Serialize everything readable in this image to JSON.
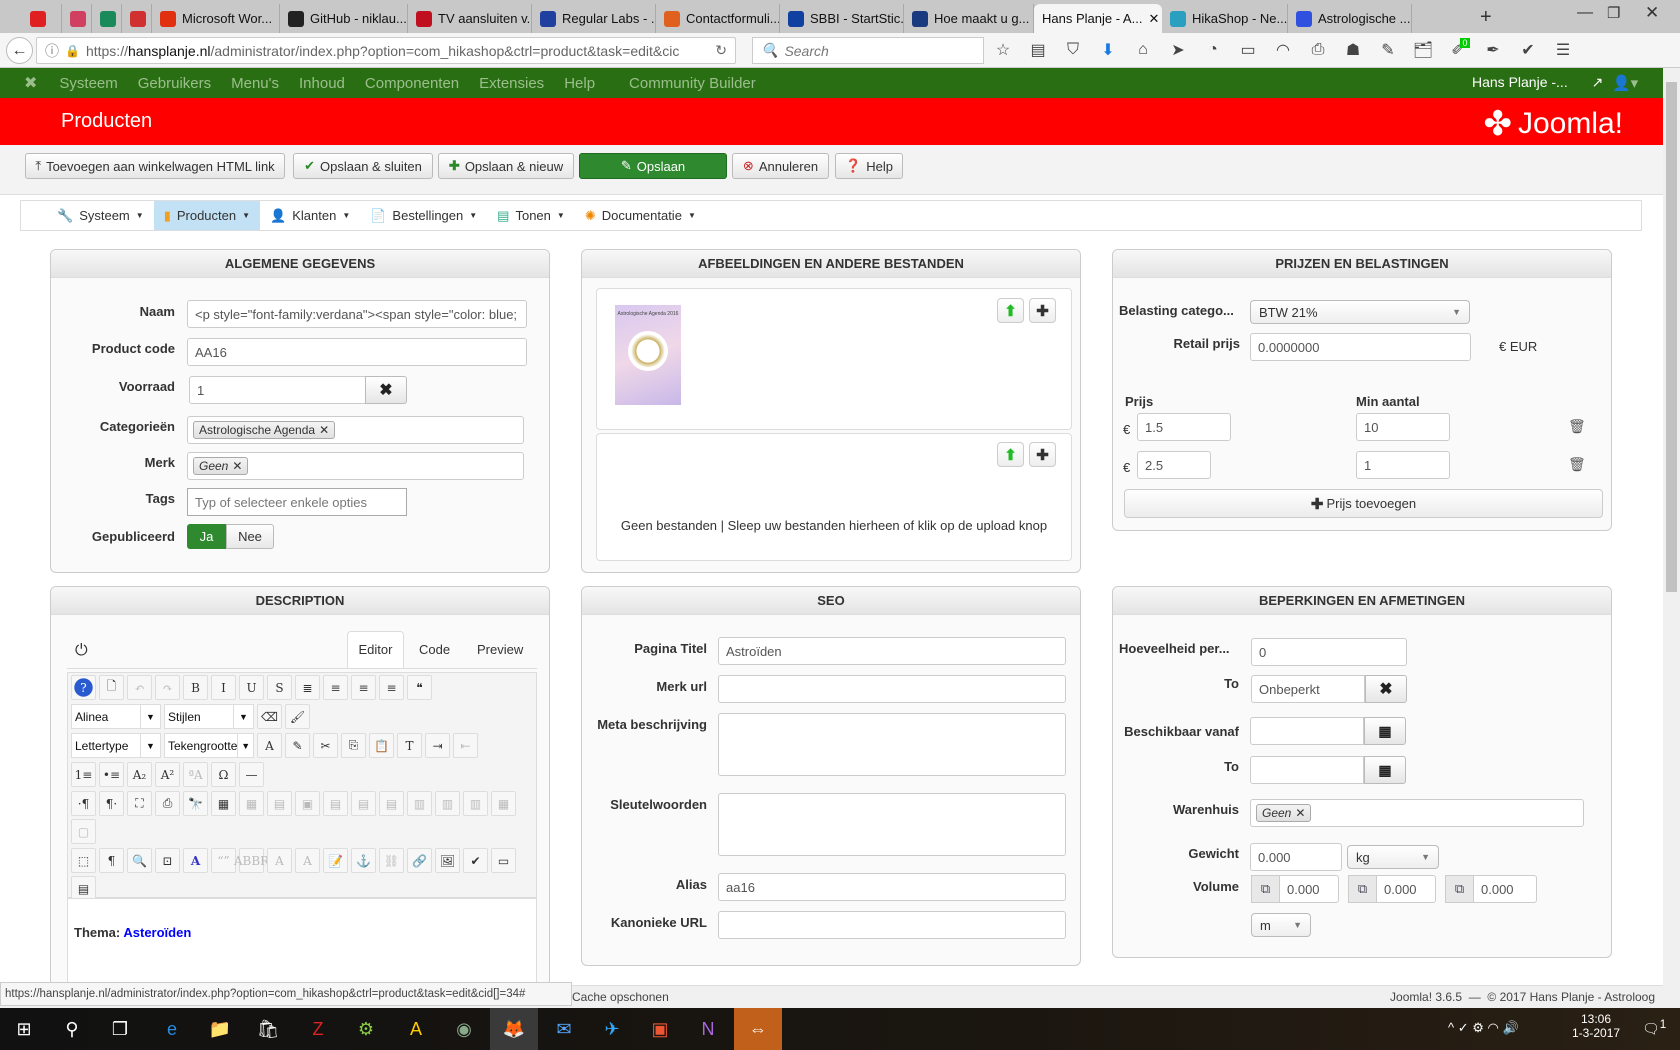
{
  "browser": {
    "tabs": [
      {
        "label": "",
        "color": "#e02020"
      },
      {
        "label": "",
        "color": "#d04060"
      },
      {
        "label": "",
        "color": "#1a8a5a"
      },
      {
        "label": "",
        "color": "#d03030"
      },
      {
        "label": "Microsoft Wor...",
        "color": "#e03010"
      },
      {
        "label": "GitHub - niklau...",
        "color": "#222"
      },
      {
        "label": "TV aansluiten v...",
        "color": "#c01020"
      },
      {
        "label": "Regular Labs - ...",
        "color": "#2040a0"
      },
      {
        "label": "Contactformuli...",
        "color": "#e06020"
      },
      {
        "label": "SBBI - StartStic...",
        "color": "#1040a0"
      },
      {
        "label": "Hoe maakt u g...",
        "color": "#1a3a80"
      },
      {
        "label": "Hans Planje - A...",
        "color": "#fff",
        "active": true
      },
      {
        "label": "HikaShop - Ne...",
        "color": "#2aa0c0"
      },
      {
        "label": "Astrologische ...",
        "color": "#3050e0"
      }
    ],
    "url_prefix": "https://",
    "url_domain": "hansplanje.nl",
    "url_path": "/administrator/index.php?option=com_hikashop&ctrl=product&task=edit&cic",
    "search_placeholder": "Search",
    "badge": "0"
  },
  "joomla": {
    "menu": [
      "Systeem",
      "Gebruikers",
      "Menu's",
      "Inhoud",
      "Componenten",
      "Extensies",
      "Help",
      "Community Builder"
    ],
    "user": "Hans Planje -...",
    "page_title": "Producten",
    "logo_text": "Joomla!",
    "toolbar": [
      "Toevoegen aan winkelwagen HTML link",
      "Opslaan & sluiten",
      "Opslaan & nieuw",
      "Opslaan",
      "Annuleren",
      "Help"
    ]
  },
  "hikamenu": [
    "Systeem",
    "Producten",
    "Klanten",
    "Bestellingen",
    "Tonen",
    "Documentatie"
  ],
  "general": {
    "title": "ALGEMENE GEGEVENS",
    "naam_label": "Naam",
    "naam": "<p style=\"font-family:verdana\"><span style=\"color: blue;",
    "code_label": "Product code",
    "code": "AA16",
    "voorraad_label": "Voorraad",
    "voorraad": "1",
    "cat_label": "Categorieën",
    "cat": "Astrologische Agenda",
    "merk_label": "Merk",
    "merk": "Geen",
    "tags_label": "Tags",
    "tags_placeholder": "Typ of selecteer enkele opties",
    "pub_label": "Gepubliceerd",
    "pub_yes": "Ja",
    "pub_no": "Nee"
  },
  "images": {
    "title": "AFBEELDINGEN EN ANDERE BESTANDEN",
    "thumb_caption": "Astrologische Agenda 2016",
    "no_files": "Geen bestanden | Sleep uw bestanden hierheen of klik op de upload knop"
  },
  "prices": {
    "title": "PRIJZEN EN BELASTINGEN",
    "tax_label": "Belasting catego...",
    "tax": "BTW 21%",
    "retail_label": "Retail prijs",
    "retail": "0.0000000",
    "currency": "€ EUR",
    "price_col": "Prijs",
    "min_col": "Min aantal",
    "euro": "€",
    "rows": [
      {
        "price": "1.5",
        "min": "10"
      },
      {
        "price": "2.5",
        "min": "1"
      }
    ],
    "add": "Prijs toevoegen"
  },
  "description": {
    "title": "DESCRIPTION",
    "tabs": [
      "Editor",
      "Code",
      "Preview"
    ],
    "toolbar_rows": [
      [
        {
          "i": "help-icon",
          "g": "?"
        },
        {
          "i": "new-document-icon",
          "g": "🗋"
        },
        {
          "i": "undo-icon",
          "g": "↶",
          "d": 1
        },
        {
          "i": "redo-icon",
          "g": "↷",
          "d": 1
        },
        {
          "i": "bold-icon",
          "g": "B"
        },
        {
          "i": "italic-icon",
          "g": "I"
        },
        {
          "i": "underline-icon",
          "g": "U"
        },
        {
          "i": "strikethrough-icon",
          "g": "S"
        },
        {
          "i": "justify-icon",
          "g": "≣"
        },
        {
          "i": "align-center-icon",
          "g": "≡"
        },
        {
          "i": "align-left-icon",
          "g": "≡"
        },
        {
          "i": "align-right-icon",
          "g": "≡"
        },
        {
          "i": "blockquote-icon",
          "g": "❝"
        }
      ],
      [
        {
          "s": "Alinea",
          "w": 90
        },
        {
          "s": "Stijlen",
          "w": 90
        },
        {
          "i": "eraser-icon",
          "g": "⌫"
        },
        {
          "i": "cleanup-brush-icon",
          "g": "🖌"
        }
      ],
      [
        {
          "s": "Lettertype",
          "w": 90
        },
        {
          "s": "Tekengrootte",
          "w": 90
        },
        {
          "i": "text-color-icon",
          "g": "A"
        },
        {
          "i": "highlight-color-icon",
          "g": "✎"
        },
        {
          "i": "cut-icon",
          "g": "✂"
        },
        {
          "i": "copy-icon",
          "g": "⎘"
        },
        {
          "i": "paste-icon",
          "g": "📋"
        },
        {
          "i": "paste-text-icon",
          "g": "T"
        },
        {
          "i": "indent-icon",
          "g": "⇥"
        },
        {
          "i": "outdent-icon",
          "g": "⇤",
          "d": 1
        }
      ],
      [
        {
          "i": "ordered-list-icon",
          "g": "1≡"
        },
        {
          "i": "bullet-list-icon",
          "g": "•≡"
        },
        {
          "i": "subscript-icon",
          "g": "A₂"
        },
        {
          "i": "superscript-icon",
          "g": "A²"
        },
        {
          "i": "case-icon",
          "g": "ªA",
          "d": 1
        },
        {
          "i": "special-char-icon",
          "g": "Ω"
        },
        {
          "i": "horizontal-rule-icon",
          "g": "—"
        }
      ],
      [
        {
          "i": "ltr-icon",
          "g": "·¶"
        },
        {
          "i": "rtl-icon",
          "g": "¶·"
        },
        {
          "i": "fullscreen-icon",
          "g": "⛶"
        },
        {
          "i": "print-icon",
          "g": "⎙"
        },
        {
          "i": "find-icon",
          "g": "🔭"
        },
        {
          "i": "table-icon",
          "g": "▦"
        },
        {
          "i": "delete-table-icon",
          "g": "▦",
          "d": 1
        },
        {
          "i": "row-props-icon",
          "g": "▤",
          "d": 1
        },
        {
          "i": "cell-props-icon",
          "g": "▣",
          "d": 1
        },
        {
          "i": "row-before-icon",
          "g": "▤",
          "d": 1
        },
        {
          "i": "row-after-icon",
          "g": "▤",
          "d": 1
        },
        {
          "i": "delete-row-icon",
          "g": "▤",
          "d": 1
        },
        {
          "i": "col-before-icon",
          "g": "▥",
          "d": 1
        },
        {
          "i": "col-after-icon",
          "g": "▥",
          "d": 1
        },
        {
          "i": "delete-col-icon",
          "g": "▥",
          "d": 1
        },
        {
          "i": "split-cells-icon",
          "g": "▦",
          "d": 1
        },
        {
          "i": "merge-cells-icon",
          "g": "▢",
          "d": 1
        }
      ],
      [
        {
          "i": "visual-aid-icon",
          "g": "⬚"
        },
        {
          "i": "show-blocks-icon",
          "g": "¶"
        },
        {
          "i": "preview-icon",
          "g": "🔍"
        },
        {
          "i": "insert-layer-icon",
          "g": "⊡"
        },
        {
          "i": "styles-icon",
          "g": "A"
        },
        {
          "i": "quote-icon",
          "g": "“”",
          "d": 1
        },
        {
          "i": "abbr-icon",
          "g": "ABBR",
          "d": 1
        },
        {
          "i": "del-icon",
          "g": "A",
          "d": 1
        },
        {
          "i": "ins-icon",
          "g": "A",
          "d": 1
        },
        {
          "i": "template-icon",
          "g": "📝"
        },
        {
          "i": "anchor-icon",
          "g": "⚓"
        },
        {
          "i": "unlink-icon",
          "g": "⛓",
          "d": 1
        },
        {
          "i": "link-icon",
          "g": "🔗"
        },
        {
          "i": "image-icon",
          "g": "🖼"
        },
        {
          "i": "spellcheck-icon",
          "g": "✔"
        },
        {
          "i": "pagebreak-icon",
          "g": "▭"
        },
        {
          "i": "readmore-icon",
          "g": "▤"
        }
      ]
    ],
    "content_label": "Thema:",
    "content_value": "Asteroïden"
  },
  "seo": {
    "title": "SEO",
    "page_title_label": "Pagina Titel",
    "page_title": "Astroïden",
    "brand_url_label": "Merk url",
    "meta_label": "Meta beschrijving",
    "keywords_label": "Sleutelwoorden",
    "alias_label": "Alias",
    "alias": "aa16",
    "canonical_label": "Kanonieke URL"
  },
  "limits": {
    "title": "BEPERKINGEN EN AFMETINGEN",
    "qty_label": "Hoeveelheid per...",
    "qty": "0",
    "to_label": "To",
    "to": "Onbeperkt",
    "avail_label": "Beschikbaar vanaf",
    "avail_to_label": "To",
    "warehouse_label": "Warenhuis",
    "warehouse": "Geen",
    "weight_label": "Gewicht",
    "weight": "0.000",
    "weight_unit": "kg",
    "volume_label": "Volume",
    "volume": [
      "0.000",
      "0.000",
      "0.000"
    ],
    "volume_unit": "m"
  },
  "status": {
    "link_preview": "https://hansplanje.nl/administrator/index.php?option=com_hikashop&ctrl=product&task=edit&cid[]=34#",
    "cache": "Cache opschonen",
    "footer": "Joomla! 3.6.5  —  © 2017 Hans Planje - Astroloog"
  },
  "taskbar": {
    "time": "13:06",
    "date": "1-3-2017",
    "notifications": "1"
  }
}
